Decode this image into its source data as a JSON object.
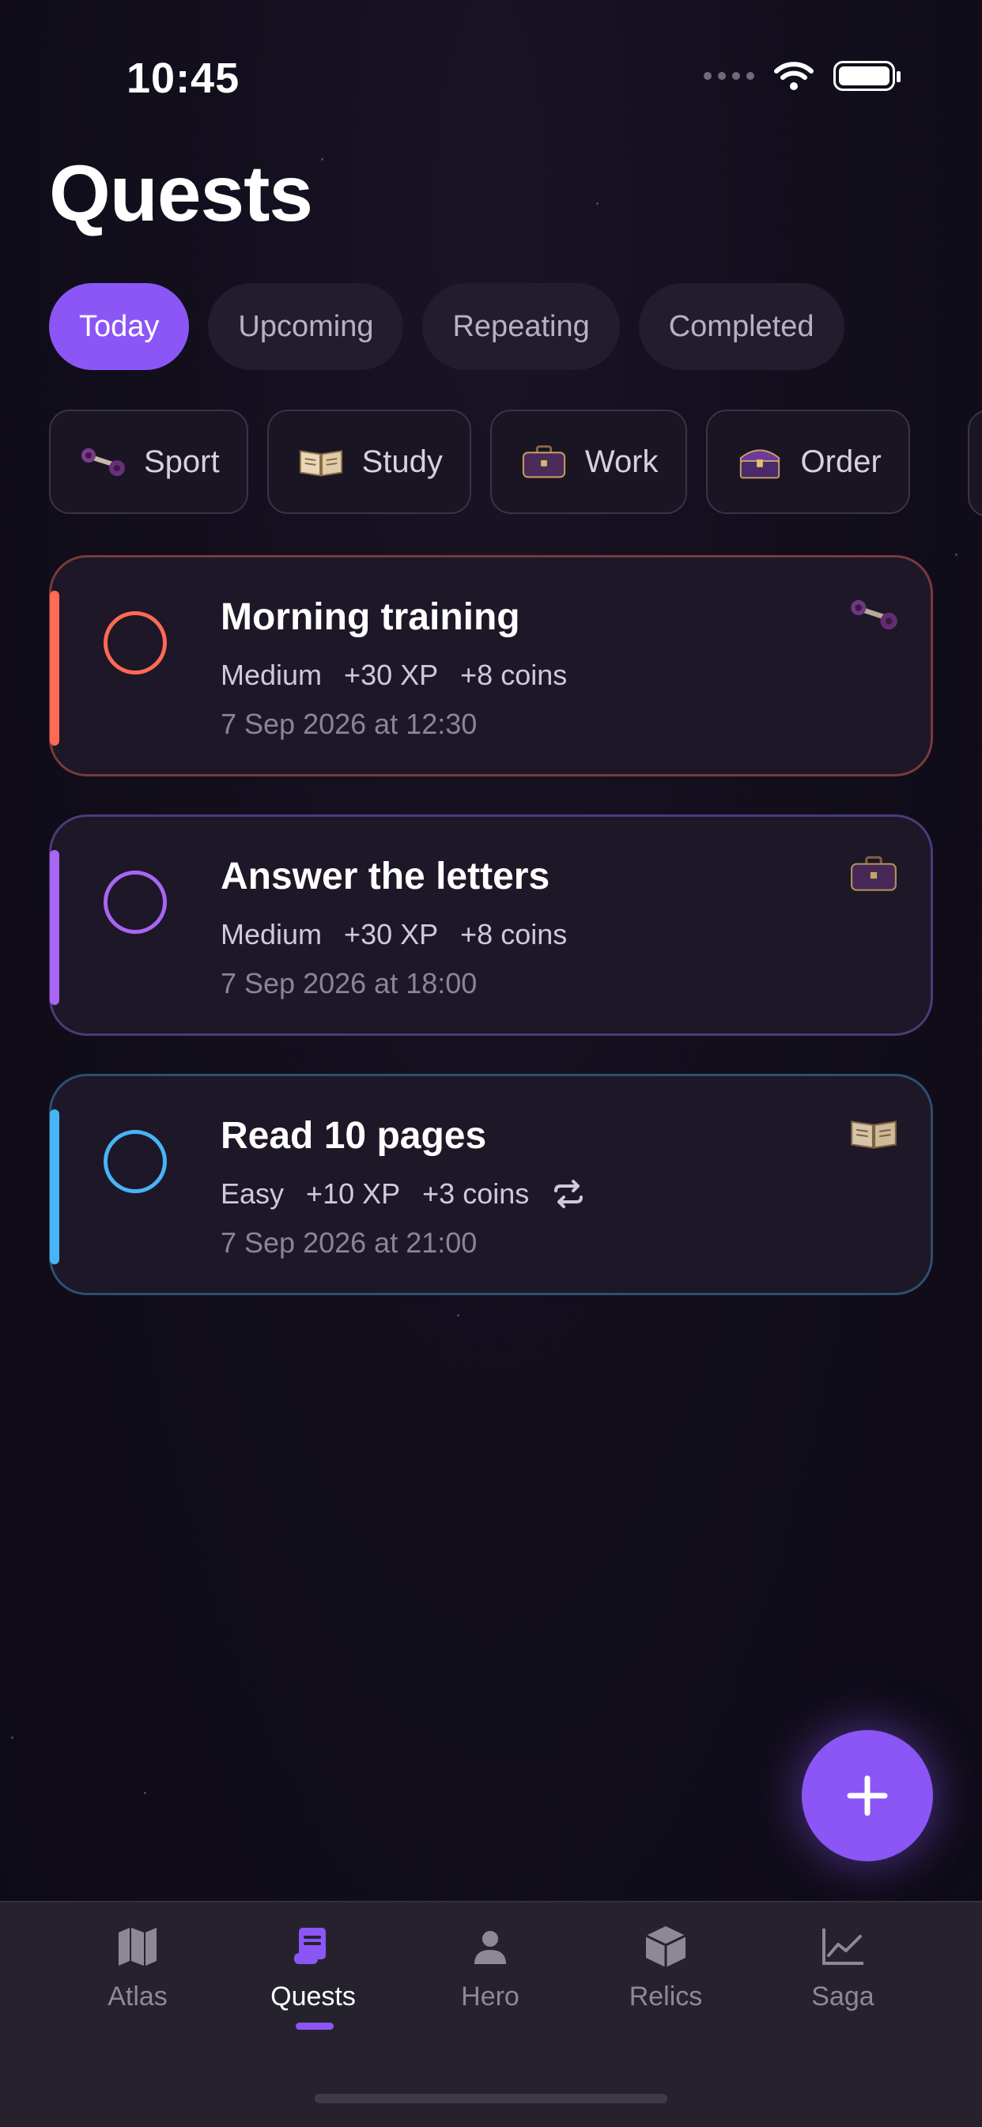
{
  "status_bar": {
    "time": "10:45"
  },
  "page_title": "Quests",
  "tabs": [
    {
      "label": "Today",
      "active": true
    },
    {
      "label": "Upcoming",
      "active": false
    },
    {
      "label": "Repeating",
      "active": false
    },
    {
      "label": "Completed",
      "active": false
    }
  ],
  "categories": [
    {
      "label": "Sport",
      "icon": "dumbbell-icon"
    },
    {
      "label": "Study",
      "icon": "open-book-icon"
    },
    {
      "label": "Work",
      "icon": "briefcase-icon"
    },
    {
      "label": "Order",
      "icon": "chest-icon"
    }
  ],
  "quests": [
    {
      "title": "Morning training",
      "difficulty": "Medium",
      "xp": "+30 XP",
      "coins": "+8 coins",
      "date": "7 Sep 2026 at 12:30",
      "color": "#ff6a55",
      "border": "#7a3a3a",
      "icon": "dumbbell-icon",
      "repeating": false
    },
    {
      "title": "Answer the letters",
      "difficulty": "Medium",
      "xp": "+30 XP",
      "coins": "+8 coins",
      "date": "7 Sep 2026 at 18:00",
      "color": "#a866f2",
      "border": "#4d3a7a",
      "icon": "briefcase-icon",
      "repeating": false
    },
    {
      "title": "Read 10 pages",
      "difficulty": "Easy",
      "xp": "+10 XP",
      "coins": "+3 coins",
      "date": "7 Sep 2026 at 21:00",
      "color": "#46b4f5",
      "border": "#2f4f6e",
      "icon": "open-book-icon",
      "repeating": true
    }
  ],
  "nav": [
    {
      "label": "Atlas",
      "icon": "map-icon",
      "active": false
    },
    {
      "label": "Quests",
      "icon": "scroll-icon",
      "active": true
    },
    {
      "label": "Hero",
      "icon": "person-icon",
      "active": false
    },
    {
      "label": "Relics",
      "icon": "box-icon",
      "active": false
    },
    {
      "label": "Saga",
      "icon": "chart-icon",
      "active": false
    }
  ],
  "colors": {
    "accent": "#8b56f5",
    "background": "#120e1c"
  }
}
